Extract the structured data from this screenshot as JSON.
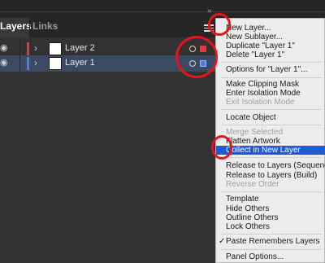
{
  "tabs": {
    "layers": "Layers",
    "links": "Links"
  },
  "collapse_chevron": "»",
  "layers": [
    {
      "name": "Layer 2",
      "color": "#e03a3a",
      "sel_color": "#e03a3a"
    },
    {
      "name": "Layer 1",
      "color": "#4d7dde",
      "sel_color": "#4d7dde"
    }
  ],
  "menu": {
    "items": [
      "New Layer...",
      "New Sublayer...",
      "Duplicate \"Layer 1\"",
      "Delete \"Layer 1\"",
      "Options for \"Layer 1\"...",
      "Make Clipping Mask",
      "Enter Isolation Mode",
      "Exit Isolation Mode",
      "Locate Object",
      "Merge Selected",
      "Flatten Artwork",
      "Collect in New Layer",
      "Release to Layers (Sequence)",
      "Release to Layers (Build)",
      "Reverse Order",
      "Template",
      "Hide Others",
      "Outline Others",
      "Lock Others",
      "Paste Remembers Layers",
      "Panel Options..."
    ],
    "check_glyph": "✓"
  },
  "colors": {
    "highlight": "#1e5bd7",
    "annotation": "#e8141b"
  }
}
